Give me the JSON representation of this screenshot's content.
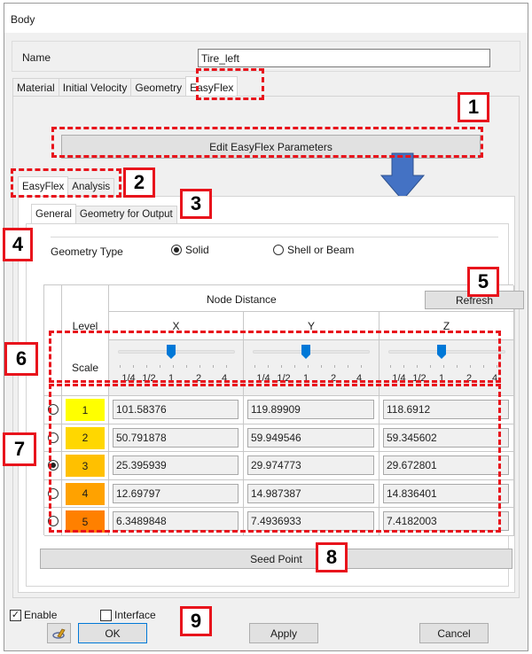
{
  "window": {
    "title": "Body"
  },
  "name_field": {
    "label": "Name",
    "value": "Tire_left"
  },
  "main_tabs": [
    {
      "label": "Material",
      "active": false
    },
    {
      "label": "Initial Velocity",
      "active": false
    },
    {
      "label": "Geometry",
      "active": false
    },
    {
      "label": "EasyFlex",
      "active": true
    }
  ],
  "edit_button": {
    "label": "Edit EasyFlex Parameters"
  },
  "sub_tabs": [
    {
      "label": "EasyFlex",
      "active": true
    },
    {
      "label": "Analysis",
      "active": false
    }
  ],
  "inner_tabs": [
    {
      "label": "General",
      "active": true
    },
    {
      "label": "Geometry for Output",
      "active": false
    }
  ],
  "geometry_type": {
    "label": "Geometry Type",
    "options": [
      {
        "label": "Solid",
        "selected": true
      },
      {
        "label": "Shell or Beam",
        "selected": false
      }
    ]
  },
  "table": {
    "level_header": "Level",
    "node_distance_header": "Node Distance",
    "refresh_label": "Refresh",
    "axis_headers": [
      "X",
      "Y",
      "Z"
    ],
    "scale_label": "Scale",
    "scale_ticks": [
      "1/4",
      "1/2",
      "1",
      "2",
      "4"
    ],
    "scale_values": {
      "X": "1",
      "Y": "1",
      "Z": "1"
    },
    "selected_level": 3,
    "rows": [
      {
        "level": "1",
        "color": "#ffff00",
        "x": "101.58376",
        "y": "119.89909",
        "z": "118.6912"
      },
      {
        "level": "2",
        "color": "#ffd700",
        "x": "50.791878",
        "y": "59.949546",
        "z": "59.345602"
      },
      {
        "level": "3",
        "color": "#ffc000",
        "x": "25.395939",
        "y": "29.974773",
        "z": "29.672801"
      },
      {
        "level": "4",
        "color": "#ffa200",
        "x": "12.69797",
        "y": "14.987387",
        "z": "14.836401"
      },
      {
        "level": "5",
        "color": "#ff8000",
        "x": "6.3489848",
        "y": "7.4936933",
        "z": "7.4182003"
      }
    ]
  },
  "seed_point_button": {
    "label": "Seed Point"
  },
  "footer": {
    "enable": {
      "label": "Enable",
      "checked": true
    },
    "interface": {
      "label": "Interface",
      "checked": false
    },
    "ok_label": "OK",
    "apply_label": "Apply",
    "cancel_label": "Cancel"
  },
  "annotations": [
    "1",
    "2",
    "3",
    "4",
    "5",
    "6",
    "7",
    "8",
    "9"
  ],
  "colors": {
    "annotation_red": "#e8141c",
    "arrow_blue": "#4472c4",
    "slider_blue": "#0078d7"
  }
}
